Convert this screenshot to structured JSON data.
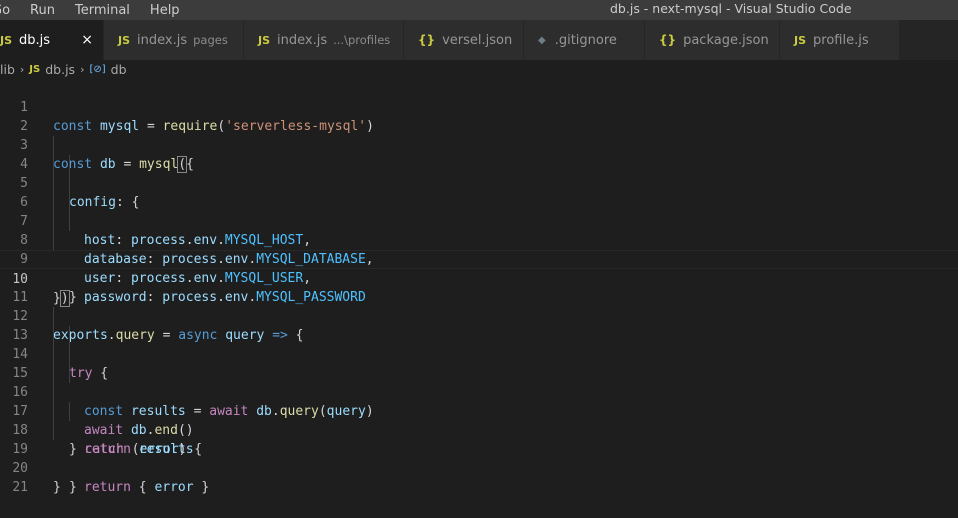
{
  "menu": [
    "Go",
    "Run",
    "Terminal",
    "Help"
  ],
  "window_title": "db.js - next-mysql - Visual Studio Code",
  "tabs": [
    {
      "icon": "JS",
      "label": "db.js",
      "desc": "",
      "active": true,
      "close": "×"
    },
    {
      "icon": "JS",
      "label": "index.js",
      "desc": "pages"
    },
    {
      "icon": "JS",
      "label": "index.js",
      "desc": "...\\profiles"
    },
    {
      "icon": "{}",
      "label": "versel.json",
      "desc": ""
    },
    {
      "icon": "◆",
      "label": ".gitignore",
      "desc": ""
    },
    {
      "icon": "{}",
      "label": "package.json",
      "desc": ""
    },
    {
      "icon": "JS",
      "label": "profile.js",
      "desc": ""
    }
  ],
  "breadcrumb": {
    "folder": "lib",
    "file_icon": "JS",
    "file": "db.js",
    "symbol_icon": "[⊘]",
    "symbol": "db"
  },
  "line_numbers": [
    "1",
    "2",
    "3",
    "4",
    "5",
    "6",
    "7",
    "8",
    "9",
    "10",
    "11",
    "12",
    "13",
    "14",
    "15",
    "16",
    "17",
    "18",
    "19",
    "20",
    "21"
  ],
  "code": {
    "l1": [
      "const",
      "mysql",
      "=",
      "require",
      "(",
      "'serverless-mysql'",
      ")"
    ],
    "l3": [
      "const",
      "db",
      "=",
      "mysql",
      "(",
      "{"
    ],
    "l4": [
      "config",
      ": {"
    ],
    "l5": [
      "host",
      ": ",
      "process",
      ".",
      "env",
      ".",
      "MYSQL_HOST",
      ","
    ],
    "l6": [
      "database",
      ": ",
      "process",
      ".",
      "env",
      ".",
      "MYSQL_DATABASE",
      ","
    ],
    "l7": [
      "user",
      ": ",
      "process",
      ".",
      "env",
      ".",
      "MYSQL_USER",
      ","
    ],
    "l8": [
      "password",
      ": ",
      "process",
      ".",
      "env",
      ".",
      "MYSQL_PASSWORD"
    ],
    "l9": [
      "}"
    ],
    "l10": [
      "}",
      ")"
    ],
    "l12": [
      "exports",
      ".",
      "query",
      " = ",
      "async",
      "query",
      "=>",
      "{"
    ],
    "l13": [
      "try",
      " {"
    ],
    "l14": [
      "const",
      "results",
      " = ",
      "await",
      "db",
      ".",
      "query",
      "(",
      "query",
      ")"
    ],
    "l15": [
      "await",
      "db",
      ".",
      "end",
      "()"
    ],
    "l16": [
      "return",
      "results"
    ],
    "l17": [
      "} ",
      "catch",
      " (",
      "error",
      ") {"
    ],
    "l18": [
      "return",
      " { ",
      "error",
      " }"
    ],
    "l19": [
      "}"
    ],
    "l20": [
      "}"
    ]
  },
  "colors": {
    "keyword": "#569cd6",
    "control": "#c586c0",
    "variable": "#9cdcfe",
    "function": "#dcdcaa",
    "string": "#ce9178",
    "constant": "#4fc1ff",
    "editor_bg": "#1e1e1e",
    "js_icon": "#cbcb41"
  }
}
